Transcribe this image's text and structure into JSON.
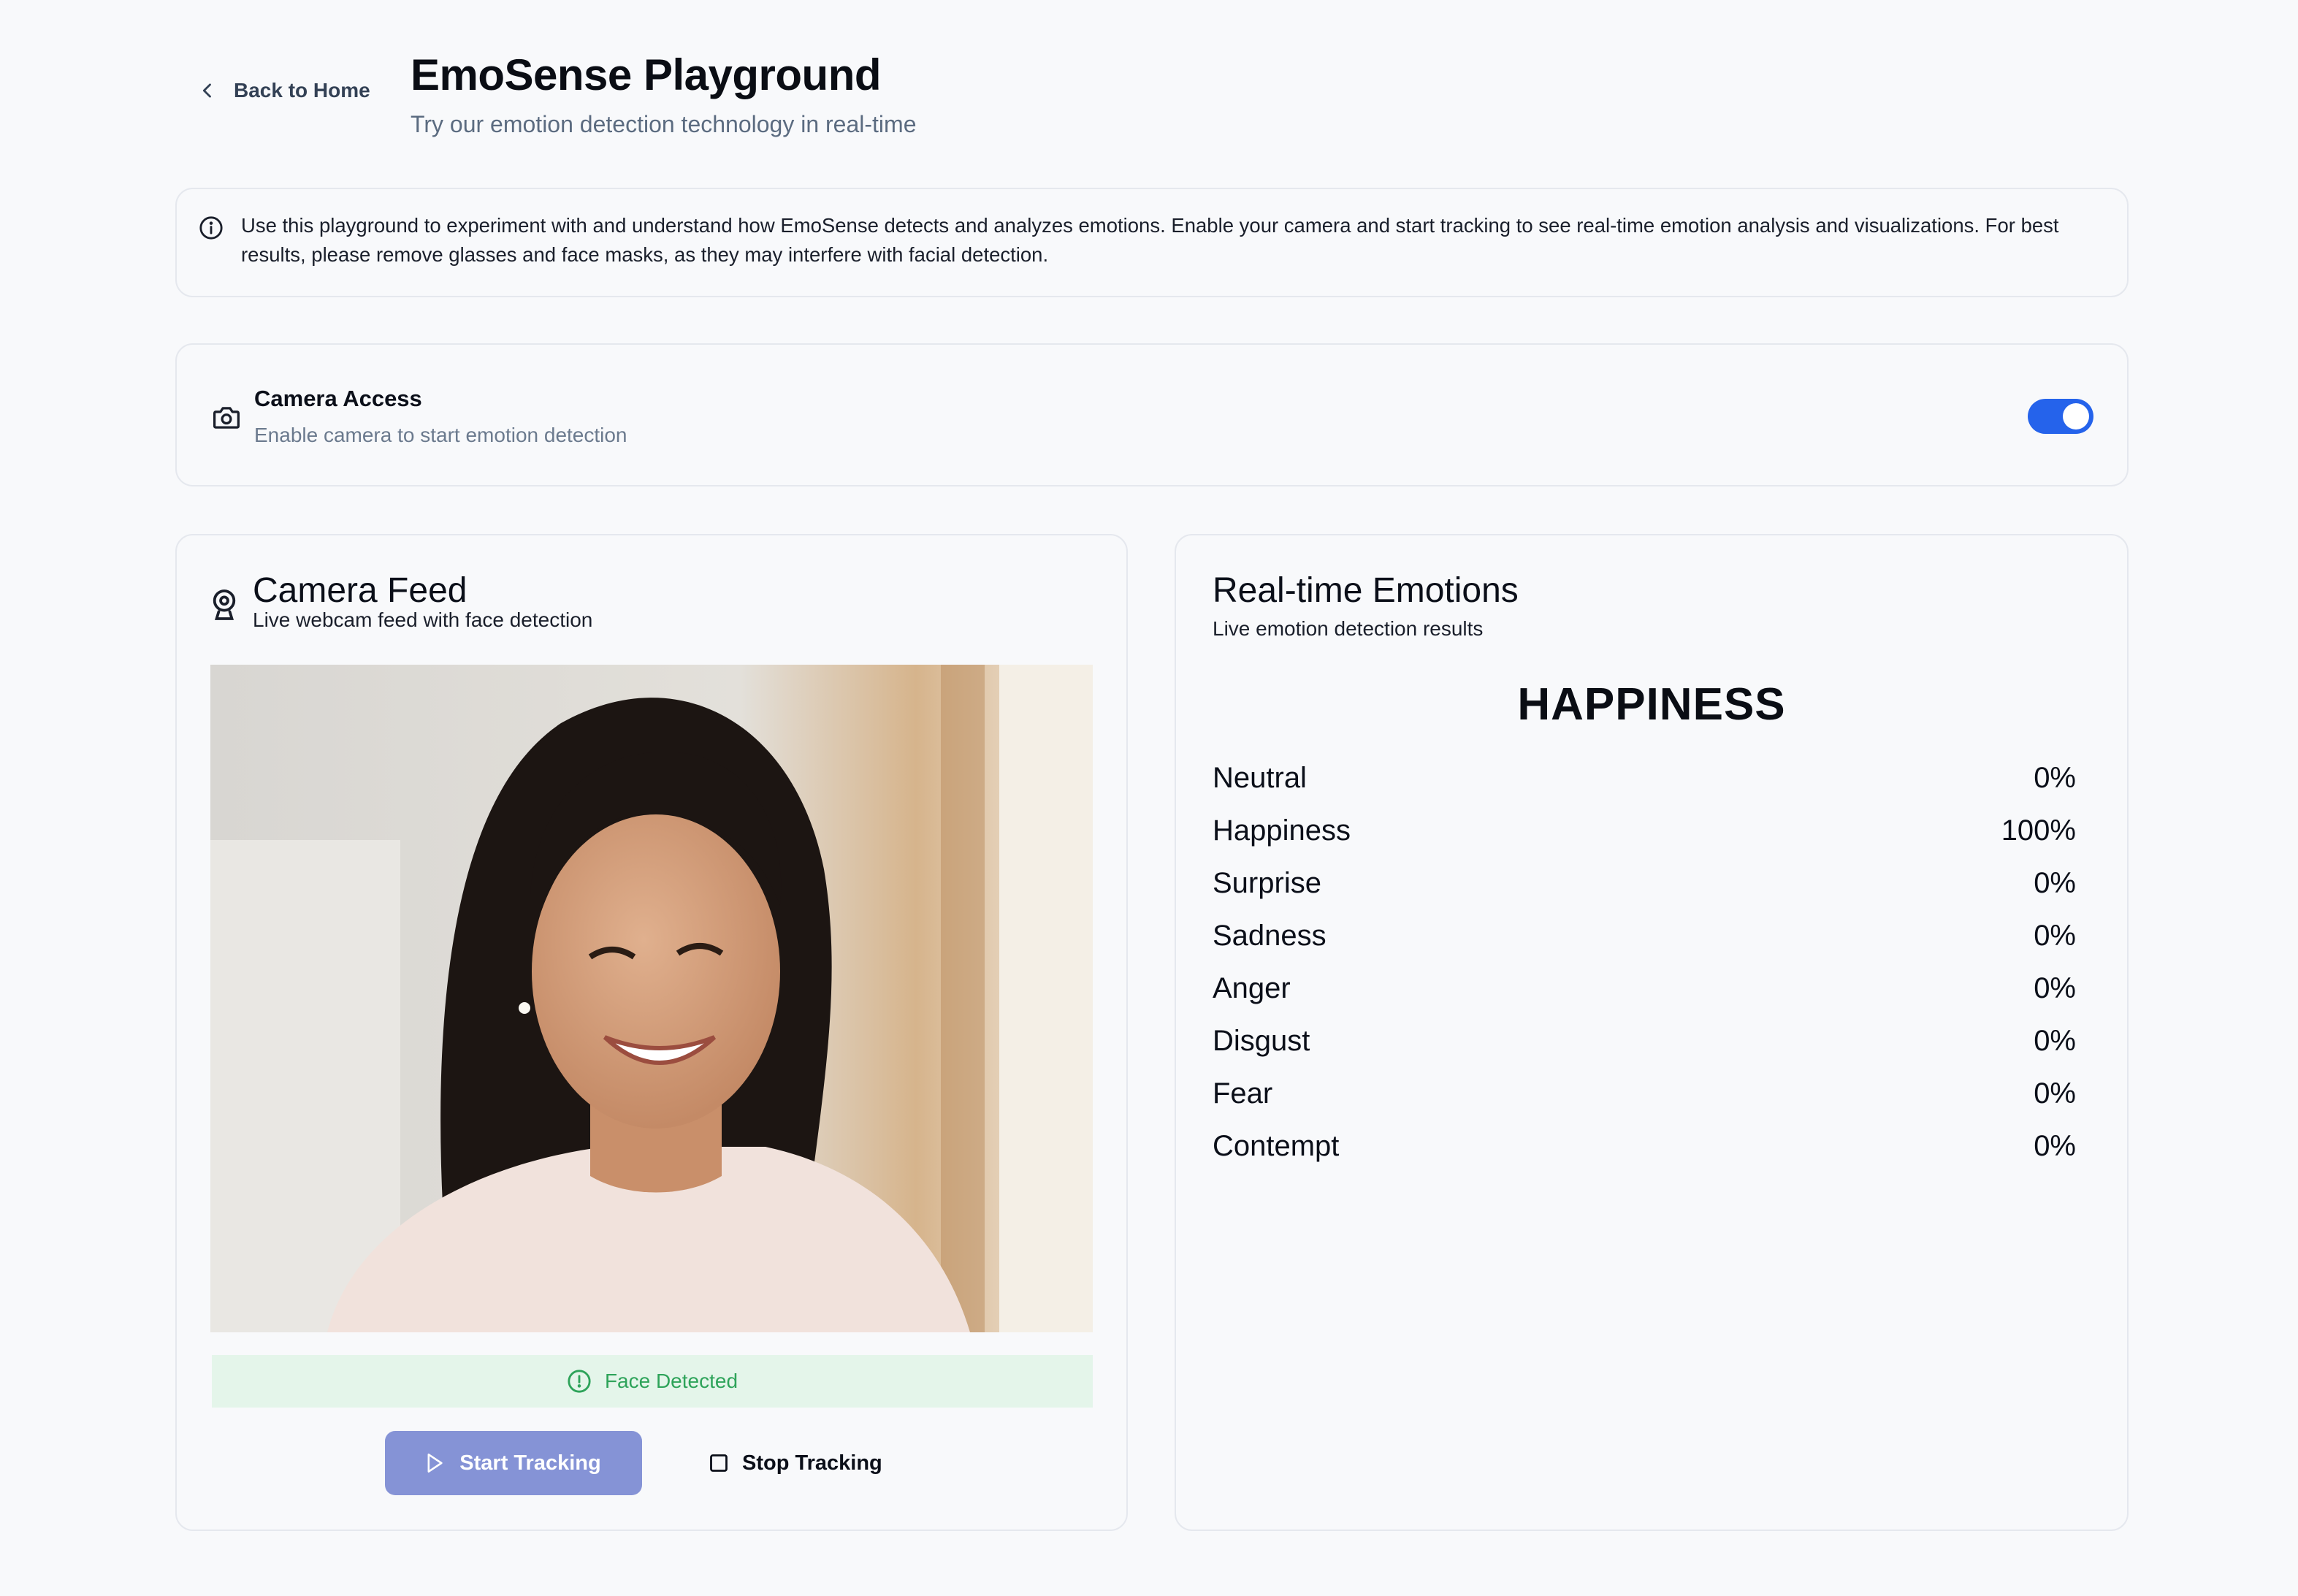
{
  "header": {
    "back_label": "Back to Home",
    "title": "EmoSense Playground",
    "subtitle": "Try our emotion detection technology in real-time"
  },
  "info_banner": {
    "text": "Use this playground to experiment with and understand how EmoSense detects and analyzes emotions. Enable your camera and start tracking to see real-time emotion analysis and visualizations. For best results, please remove glasses and face masks, as they may interfere with facial detection."
  },
  "camera_access": {
    "title": "Camera Access",
    "subtitle": "Enable camera to start emotion detection",
    "enabled": true,
    "toggle_color": "#2563eb"
  },
  "camera_feed": {
    "title": "Camera Feed",
    "subtitle": "Live webcam feed with face detection",
    "status": "Face Detected",
    "status_color": "#2ea35a",
    "start_label": "Start Tracking",
    "stop_label": "Stop Tracking"
  },
  "emotions": {
    "title": "Real-time Emotions",
    "subtitle": "Live emotion detection results",
    "dominant": "HAPPINESS",
    "items": [
      {
        "name": "Neutral",
        "value": "0%"
      },
      {
        "name": "Happiness",
        "value": "100%"
      },
      {
        "name": "Surprise",
        "value": "0%"
      },
      {
        "name": "Sadness",
        "value": "0%"
      },
      {
        "name": "Anger",
        "value": "0%"
      },
      {
        "name": "Disgust",
        "value": "0%"
      },
      {
        "name": "Fear",
        "value": "0%"
      },
      {
        "name": "Contempt",
        "value": "0%"
      }
    ]
  },
  "icons": {
    "back": "chevron-left-icon",
    "info": "info-icon",
    "camera": "camera-icon",
    "webcam": "webcam-icon",
    "status": "alert-circle-icon",
    "start": "play-icon",
    "stop": "square-icon"
  }
}
